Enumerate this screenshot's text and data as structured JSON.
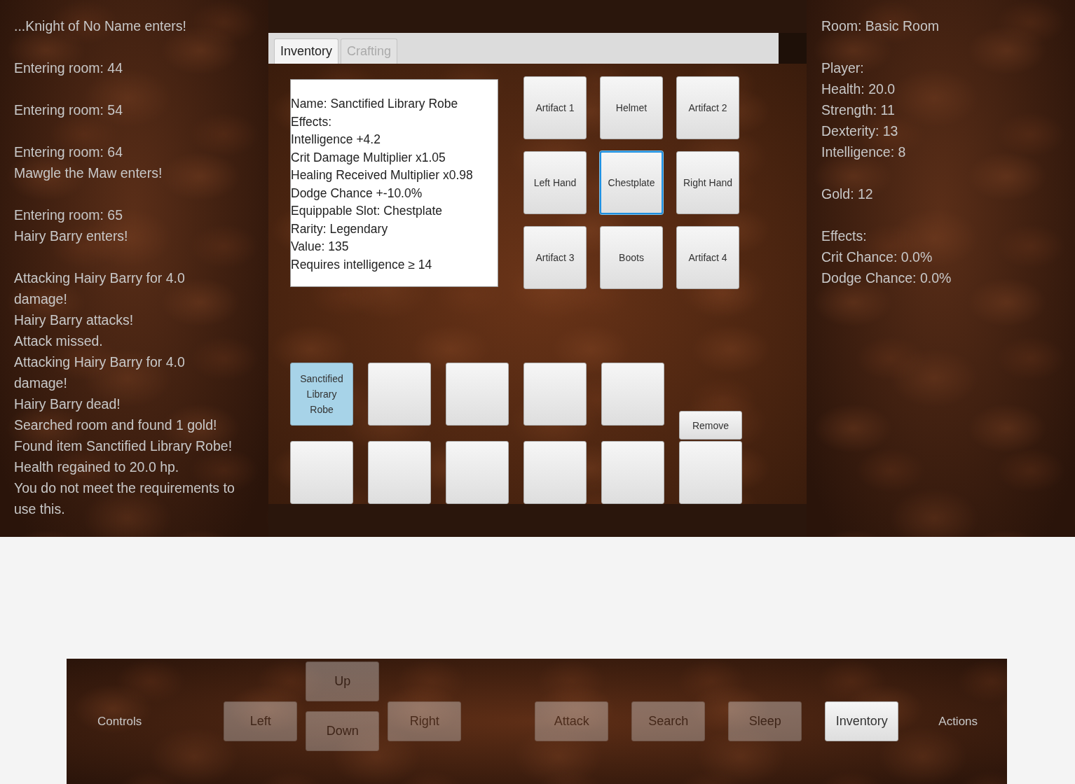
{
  "log": [
    [
      "...Knight of No Name enters!"
    ],
    [
      "Entering room: 44"
    ],
    [
      "Entering room: 54"
    ],
    [
      "Entering room: 64",
      "Mawgle the Maw enters!"
    ],
    [
      "Entering room: 65",
      "Hairy Barry enters!"
    ],
    [
      "Attacking Hairy Barry for 4.0 damage!",
      "Hairy Barry attacks!",
      "Attack missed.",
      "Attacking Hairy Barry for 4.0 damage!",
      "Hairy Barry dead!",
      "Searched room and found 1 gold!",
      "Found item Sanctified Library Robe!",
      "Health regained to 20.0 hp.",
      "You do not meet the requirements to use this."
    ]
  ],
  "tabs": [
    {
      "label": "Inventory",
      "selected": true
    },
    {
      "label": "Crafting",
      "selected": false
    }
  ],
  "item_details": [
    "Name: Sanctified Library Robe",
    "Effects:",
    "Intelligence +4.2",
    "Crit Damage Multiplier x1.05",
    "Healing Received Multiplier x0.98",
    "Dodge Chance +-10.0%",
    "Equippable Slot: Chestplate",
    "Rarity: Legendary",
    "Value: 135",
    "Requires intelligence ≥ 14"
  ],
  "equipment_slots": [
    {
      "label": "Artifact 1",
      "selected": false
    },
    {
      "label": "Helmet",
      "selected": false
    },
    {
      "label": "Artifact 2",
      "selected": false
    },
    {
      "label": "Left Hand",
      "selected": false
    },
    {
      "label": "Chestplate",
      "selected": true
    },
    {
      "label": "Right Hand",
      "selected": false
    },
    {
      "label": "Artifact 3",
      "selected": false
    },
    {
      "label": "Boots",
      "selected": false
    },
    {
      "label": "Artifact 4",
      "selected": false
    }
  ],
  "inventory_slots": [
    {
      "label": "Sanctified Library Robe",
      "selected": true
    },
    {
      "selected": false
    },
    {
      "selected": false
    },
    {
      "selected": false
    },
    {
      "selected": false
    },
    {
      "selected": false
    },
    {
      "selected": false
    },
    {
      "selected": false
    },
    {
      "selected": false
    },
    {
      "selected": false
    },
    {
      "selected": false
    }
  ],
  "remove_button": "Remove",
  "stats": [
    [
      "Room: Basic Room"
    ],
    [
      "Player:",
      "Health: 20.0",
      "Strength: 11",
      "Dexterity: 13",
      "Intelligence: 8"
    ],
    [
      "Gold: 12"
    ],
    [
      "Effects:",
      "Crit Chance: 0.0%",
      "Dodge Chance: 0.0%"
    ]
  ],
  "controls": {
    "label": "Controls",
    "buttons": [
      {
        "kind": "left",
        "label": "Left",
        "disabled": true
      },
      {
        "kind": "up",
        "label": "Up",
        "disabled": true
      },
      {
        "kind": "down",
        "label": "Down",
        "disabled": true
      },
      {
        "kind": "right",
        "label": "Right",
        "disabled": true
      }
    ]
  },
  "actions": {
    "label": "Actions",
    "buttons": [
      {
        "label": "Attack",
        "disabled": true
      },
      {
        "label": "Search",
        "disabled": true
      },
      {
        "label": "Sleep",
        "disabled": true
      },
      {
        "label": "Inventory",
        "disabled": false
      }
    ]
  }
}
